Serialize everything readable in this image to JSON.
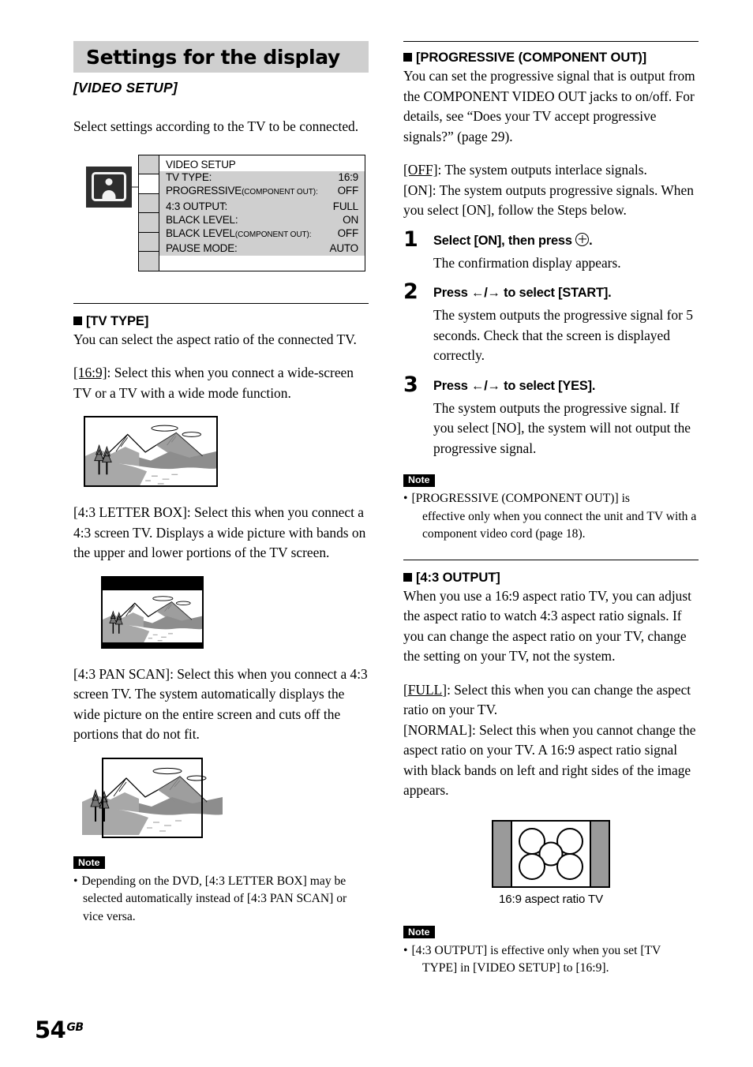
{
  "page": {
    "number": "54",
    "region_code": "GB"
  },
  "left": {
    "banner_title": "Settings for the display",
    "subtitle": "[VIDEO SETUP]",
    "intro": "Select settings according to the TV to be connected.",
    "osd": {
      "icon_name": "video-setup-icon",
      "heading": "VIDEO SETUP",
      "rows": [
        {
          "label": "TV TYPE:",
          "sub": "",
          "value": "16:9"
        },
        {
          "label": "PROGRESSIVE",
          "sub": "(COMPONENT OUT):",
          "value": "OFF"
        },
        {
          "label": "4:3 OUTPUT:",
          "sub": "",
          "value": "FULL"
        },
        {
          "label": "BLACK LEVEL:",
          "sub": "",
          "value": "ON"
        },
        {
          "label": "BLACK LEVEL",
          "sub": "(COMPONENT OUT):",
          "value": "OFF"
        },
        {
          "label": "PAUSE MODE:",
          "sub": "",
          "value": "AUTO"
        }
      ]
    },
    "tv_type": {
      "heading": "[TV TYPE]",
      "body": "You can select the aspect ratio of the connected TV.",
      "option_169_key": "[16:9]",
      "option_169_text": ": Select this when you connect a wide-screen TV or a TV with a wide mode function.",
      "fig_169_name": "widescreen-mountain-illustration",
      "option_lb_text": "[4:3 LETTER BOX]: Select this when you connect a 4:3 screen TV. Displays a wide picture with bands on the upper and lower portions of the TV screen.",
      "fig_lb_name": "letterbox-mountain-illustration",
      "option_ps_text": "[4:3 PAN SCAN]: Select this when you connect a 4:3 screen TV. The system automatically displays the wide picture on the entire screen and cuts off the portions that do not fit.",
      "fig_ps_name": "pan-scan-mountain-illustration"
    },
    "note": {
      "tag": "Note",
      "items": [
        "Depending on the DVD, [4:3 LETTER BOX] may be selected automatically instead of [4:3 PAN SCAN] or vice versa."
      ]
    }
  },
  "right": {
    "progressive": {
      "heading": "[PROGRESSIVE (COMPONENT OUT)]",
      "body": "You can set the progressive signal that is output from the COMPONENT VIDEO OUT jacks to on/off. For details, see “Does your TV accept progressive signals?” (page 29).",
      "option_off_key": "[OFF]",
      "option_off_text": ": The system outputs interlace signals.",
      "option_on_text": "[ON]: The system outputs progressive signals. When you select [ON], follow the Steps below.",
      "steps": [
        {
          "num": "1",
          "head_before": "Select [ON], then press",
          "head_glyph": "enter-button-icon",
          "head_after": ".",
          "body": "The confirmation display appears."
        },
        {
          "num": "2",
          "head_before": "Press ←/→ to select [START].",
          "head_glyph": "",
          "head_after": "",
          "body": "The system outputs the progressive signal for 5 seconds. Check that the screen is displayed correctly."
        },
        {
          "num": "3",
          "head_before": " Press ←/→ to select [YES].",
          "head_glyph": "",
          "head_after": "",
          "body": "The system outputs the progressive signal. If you select [NO], the system will not output the progressive signal."
        }
      ],
      "note": {
        "tag": "Note",
        "line1": "[PROGRESSIVE (COMPONENT OUT)] is",
        "line2": "effective only when you connect the unit and TV with a component video cord (page 18)."
      }
    },
    "output43": {
      "heading": "[4:3 OUTPUT]",
      "body": "When you use a 16:9 aspect ratio TV, you can adjust the aspect ratio to watch 4:3 aspect ratio signals. If you can change the aspect ratio on your TV, change the setting on your TV, not the system.",
      "option_full_key": "[FULL]",
      "option_full_text": ": Select this when you can change the aspect ratio on your TV.",
      "option_normal_text": "[NORMAL]: Select this when you cannot change the aspect ratio on your TV. A 16:9 aspect ratio signal with black bands on left and right sides of the image appears.",
      "figure_caption": "16:9 aspect ratio TV",
      "figure_name": "sixteen-nine-aspect-ratio-tv-illustration",
      "note": {
        "tag": "Note",
        "line1": "[4:3 OUTPUT] is effective only when you set [TV",
        "line2": "TYPE] in [VIDEO SETUP] to [16:9]."
      }
    }
  },
  "colors": {
    "banner_gray": "#cfcfcf",
    "osd_row_gray": "#cfcfcf",
    "band_gray": "#9a9a9a",
    "ink": "#000000"
  }
}
